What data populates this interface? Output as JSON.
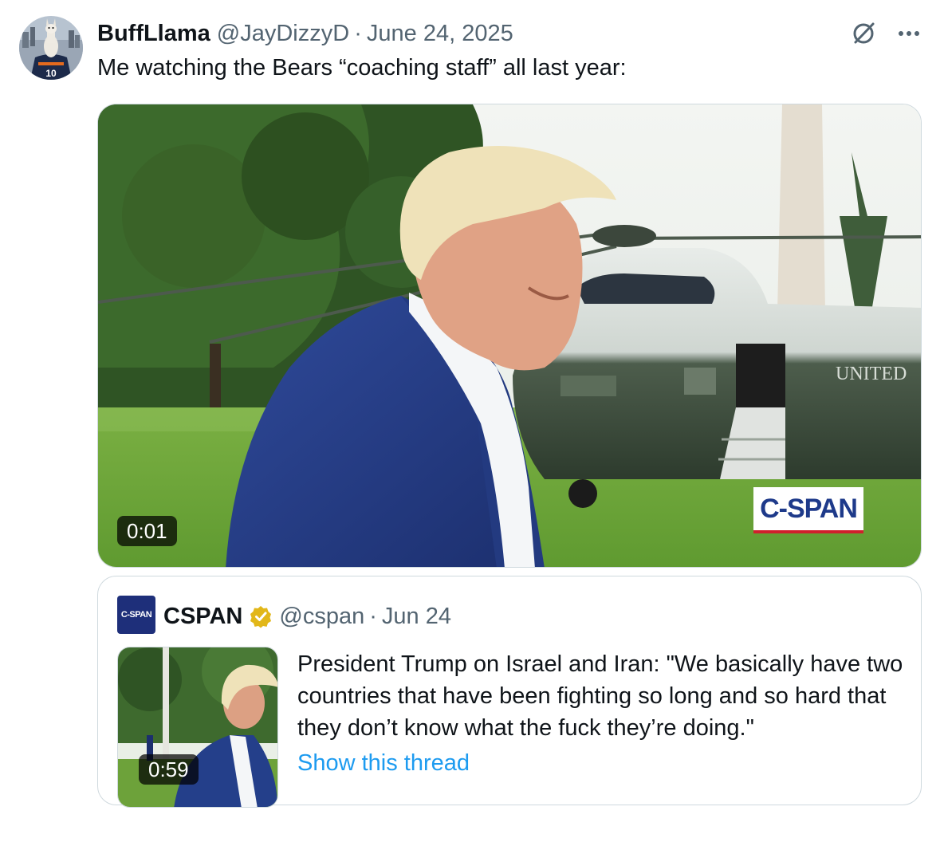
{
  "tweet": {
    "author": {
      "display_name": "BuffLlama",
      "handle": "@JayDizzyD"
    },
    "separator": "·",
    "date": "June 24, 2025",
    "text": "Me watching the Bears “coaching staff” all last year:",
    "media": {
      "duration": "0:01",
      "watermark": "C-SPAN",
      "aircraft_lettering": "UNITED"
    },
    "icons": {
      "grok": "grok-icon",
      "more": "more-options-icon",
      "avatar_jersey_number": "10"
    }
  },
  "quoted_tweet": {
    "avatar_text": "C-SPAN",
    "display_name": "CSPAN",
    "verified": true,
    "verified_color": "#e2b719",
    "handle": "@cspan",
    "separator": "·",
    "date": "Jun 24",
    "text": "President Trump on Israel and Iran: \"We basically have two countries that have been fighting so long and so hard that they don’t know what the fuck they’re doing.\"",
    "show_thread": "Show this thread",
    "media": {
      "duration": "0:59"
    }
  },
  "colors": {
    "link": "#1d9bf0",
    "secondary_text": "#536471",
    "border": "#cfd9de",
    "cspan_blue": "#1e3a8a",
    "cspan_red": "#d0202c"
  }
}
